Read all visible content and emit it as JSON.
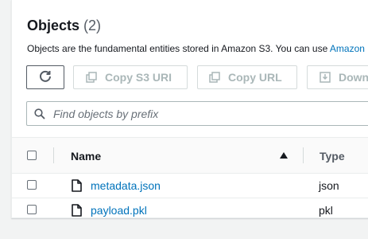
{
  "header": {
    "title": "Objects",
    "count": "(2)",
    "description": "Objects are the fundamental entities stored in Amazon S3. You can use ",
    "description_link": "Amazon"
  },
  "toolbar": {
    "refresh_icon": "refresh-icon",
    "copy_s3_uri_label": "Copy S3 URI",
    "copy_url_label": "Copy URL",
    "download_label": "Down"
  },
  "search": {
    "placeholder": "Find objects by prefix",
    "value": ""
  },
  "table": {
    "columns": {
      "name": "Name",
      "type": "Type"
    },
    "sort": "name-ascending",
    "rows": [
      {
        "name": "metadata.json",
        "type": "json"
      },
      {
        "name": "payload.pkl",
        "type": "pkl"
      }
    ]
  },
  "colors": {
    "link": "#0073bb",
    "text": "#16191f",
    "disabled": "#aab7b8",
    "background": "#f2f3f3"
  }
}
